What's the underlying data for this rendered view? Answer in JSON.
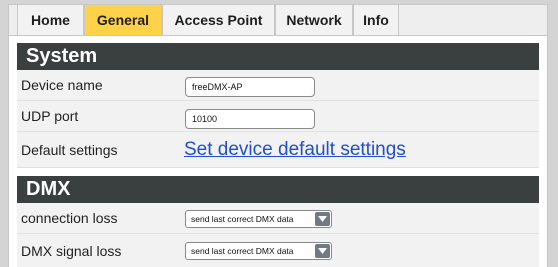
{
  "tabs": [
    {
      "label": "Home",
      "active": false
    },
    {
      "label": "General",
      "active": true
    },
    {
      "label": "Access Point",
      "active": false
    },
    {
      "label": "Network",
      "active": false
    },
    {
      "label": "Info",
      "active": false
    }
  ],
  "colors": {
    "active_tab": "#ffd24a",
    "section_header": "#3a3f40",
    "link": "#1f4fd1",
    "dropdown_arrow_bg": "#6f7a86"
  },
  "system": {
    "title": "System",
    "device_name_label": "Device name",
    "device_name_value": "freeDMX-AP",
    "udp_port_label": "UDP port",
    "udp_port_value": "10100",
    "default_settings_label": "Default settings",
    "default_settings_link": "Set device default settings"
  },
  "dmx": {
    "title": "DMX",
    "connection_loss_label": "connection loss",
    "connection_loss_value": "send last correct DMX data",
    "dropdown_icon": "chevron-down-icon",
    "signal_loss_label": "DMX signal loss",
    "signal_loss_value": "send last correct DMX data"
  }
}
